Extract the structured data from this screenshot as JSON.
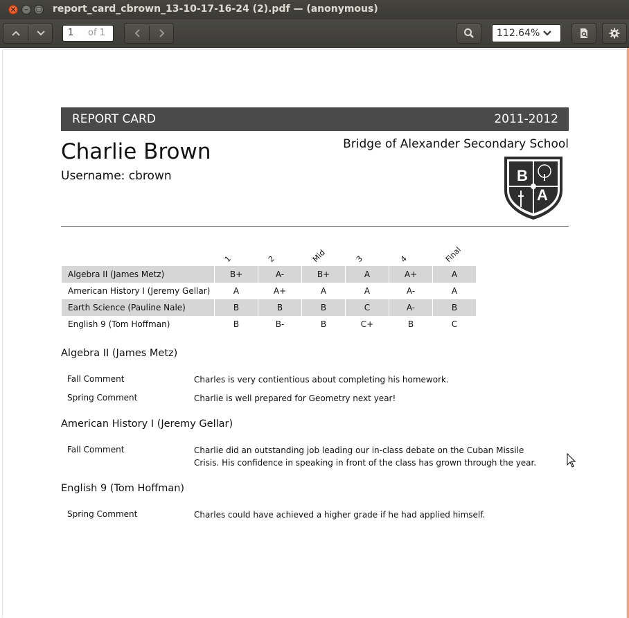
{
  "window": {
    "title": "report_card_cbrown_13-10-17-16-24 (2).pdf — (anonymous)"
  },
  "toolbar": {
    "page_current": "1",
    "page_of": "of 1",
    "zoom": "112.64%"
  },
  "report": {
    "banner_title": "REPORT CARD",
    "banner_year": "2011-2012",
    "student_name": "Charlie Brown",
    "username": "Username: cbrown",
    "school": "Bridge of Alexander Secondary School",
    "crest_letters": [
      "B",
      "A"
    ],
    "grade_columns": [
      "1",
      "2",
      "Mid",
      "3",
      "4",
      "Final"
    ],
    "grades": [
      {
        "subject": "Algebra II (James Metz)",
        "marks": [
          "B+",
          "A-",
          "B+",
          "A",
          "A+",
          "A"
        ]
      },
      {
        "subject": "American History I (Jeremy Gellar)",
        "marks": [
          "A",
          "A+",
          "A",
          "A",
          "A-",
          "A"
        ]
      },
      {
        "subject": "Earth Science (Pauline Nale)",
        "marks": [
          "B",
          "B",
          "B",
          "C",
          "A-",
          "B"
        ]
      },
      {
        "subject": "English 9 (Tom Hoffman)",
        "marks": [
          "B",
          "B-",
          "B",
          "C+",
          "B",
          "C"
        ]
      }
    ],
    "comments": [
      {
        "course": "Algebra II (James Metz)",
        "entries": [
          {
            "label": "Fall Comment",
            "text": "Charles is very contientious about completing his homework."
          },
          {
            "label": "Spring Comment",
            "text": "Charlie is well prepared for Geometry next year!"
          }
        ]
      },
      {
        "course": "American History I (Jeremy Gellar)",
        "entries": [
          {
            "label": "Fall Comment",
            "text": "Charlie did an outstanding job leading our in-class debate on the Cuban Missile Crisis. His confidence in speaking in front of the class has grown through the year."
          }
        ]
      },
      {
        "course": "English 9 (Tom Hoffman)",
        "entries": [
          {
            "label": "Spring Comment",
            "text": "Charles could have achieved a higher grade if he had applied himself."
          }
        ]
      }
    ]
  }
}
